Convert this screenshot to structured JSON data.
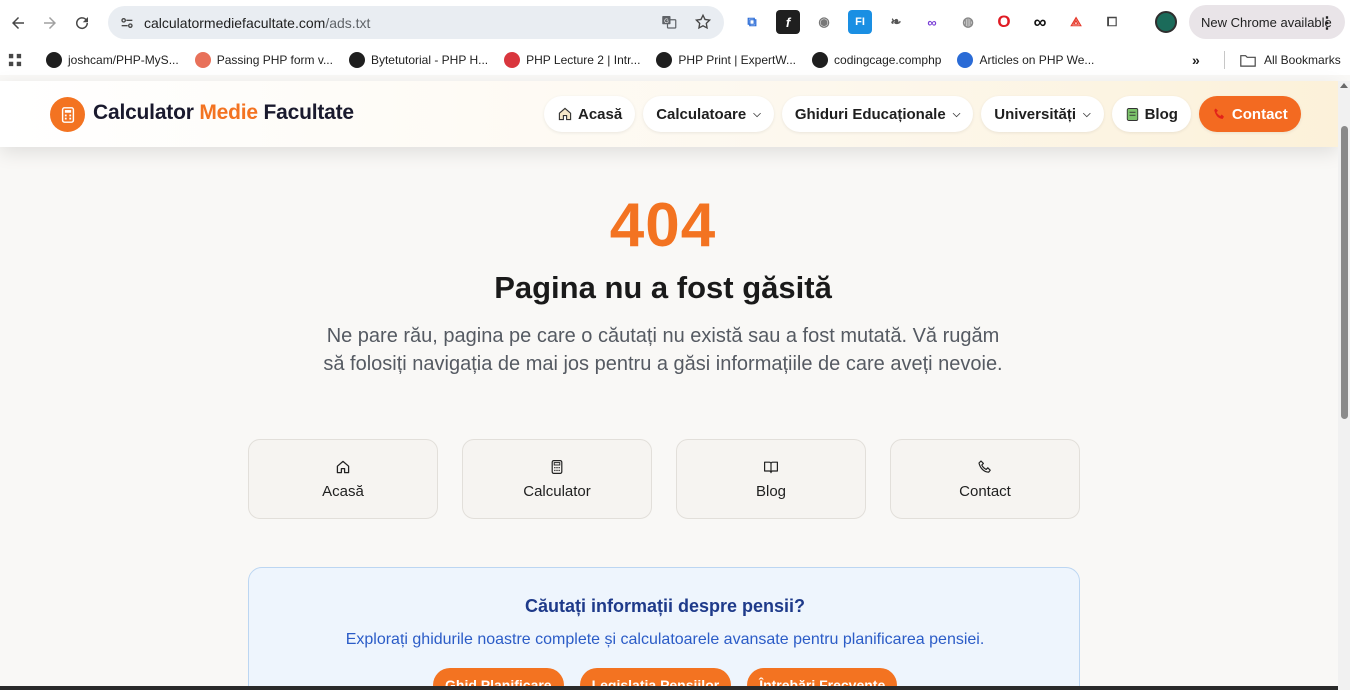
{
  "browser": {
    "url_host": "calculatormediefacultate.com",
    "url_path": "/ads.txt",
    "update_label": "New Chrome available",
    "bookmarks": [
      {
        "label": "joshcam/PHP-MyS...",
        "icon": "github-icon",
        "color": "#1f1f1f"
      },
      {
        "label": "Passing PHP form v...",
        "icon": "page-icon",
        "color": "#e8715a"
      },
      {
        "label": "Bytetutorial - PHP H...",
        "icon": "globe-icon",
        "color": "#1f1f1f"
      },
      {
        "label": "PHP Lecture 2 | Intr...",
        "icon": "lecture-icon",
        "color": "#d9363e"
      },
      {
        "label": "PHP Print | ExpertW...",
        "icon": "globe-icon",
        "color": "#1f1f1f"
      },
      {
        "label": "codingcage.comphp",
        "icon": "cc-icon",
        "color": "#1f1f1f"
      },
      {
        "label": "Articles on PHP We...",
        "icon": "arrow-icon",
        "color": "#2a6bd6"
      }
    ],
    "all_bookmarks_label": "All Bookmarks"
  },
  "site": {
    "logo_part1": "Calculator ",
    "logo_part2": "Medie",
    "logo_part3": " Facultate",
    "nav": {
      "home": "Acasă",
      "calculators": "Calculatoare",
      "guides": "Ghiduri Educaționale",
      "universities": "Universități",
      "blog": "Blog",
      "contact": "Contact"
    },
    "colors": {
      "accent": "#f37321",
      "promo_title": "#1e3a8a",
      "promo_text": "#2b5cc7"
    }
  },
  "error": {
    "code": "404",
    "title": "Pagina nu a fost găsită",
    "description": "Ne pare rău, pagina pe care o căutați nu există sau a fost mutată. Vă rugăm să folosiți navigația de mai jos pentru a găsi informațiile de care aveți nevoie."
  },
  "quick_links": [
    {
      "label": "Acasă",
      "icon": "home-icon"
    },
    {
      "label": "Calculator",
      "icon": "calculator-icon"
    },
    {
      "label": "Blog",
      "icon": "book-icon"
    },
    {
      "label": "Contact",
      "icon": "phone-icon"
    }
  ],
  "promo": {
    "title": "Căutați informații despre pensii?",
    "subtitle": "Explorați ghidurile noastre complete și calculatoarele avansate pentru planificarea pensiei.",
    "buttons": [
      "Ghid Planificare",
      "Legislația Pensiilor",
      "Întrebări Frecvente"
    ]
  }
}
